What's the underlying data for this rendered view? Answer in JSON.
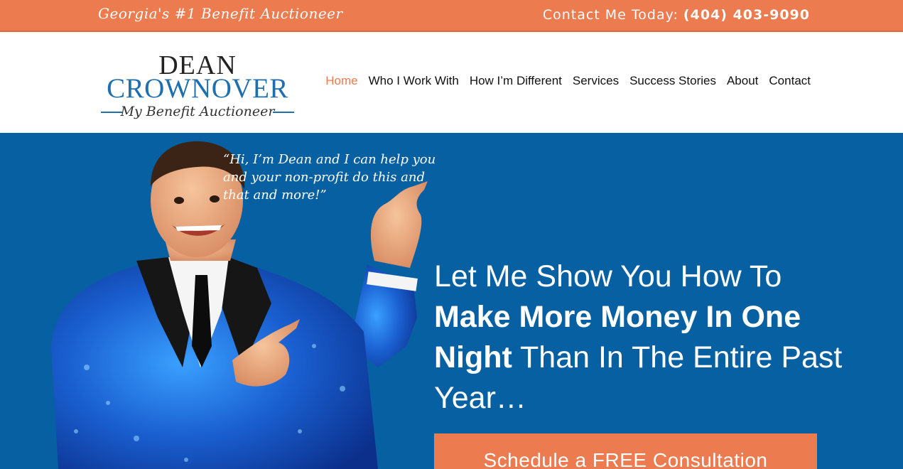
{
  "topbar": {
    "tagline": "Georgia's #1 Benefit Auctioneer",
    "contact_label": "Contact Me Today:",
    "phone": "(404) 403-9090"
  },
  "logo": {
    "line1": "DEAN",
    "line2": "CROWNOVER",
    "line3": "My Benefit Auctioneer"
  },
  "nav": {
    "items": [
      {
        "label": "Home",
        "active": true
      },
      {
        "label": "Who I Work With"
      },
      {
        "label": "How I’m Different"
      },
      {
        "label": "Services"
      },
      {
        "label": "Success Stories"
      },
      {
        "label": "About"
      },
      {
        "label": "Contact"
      }
    ]
  },
  "hero": {
    "speech_line1": "“Hi, I’m Dean and I can help you",
    "speech_line2": "and your non-profit do this and",
    "speech_line3": "that and more!”",
    "headline_part1": "Let Me Show You How To",
    "headline_bold": "Make More Money In One Night",
    "headline_part2": "Than In The Entire Past Year…",
    "cta_label": "Schedule a FREE Consultation"
  },
  "colors": {
    "accent": "#ec7b50",
    "hero_bg": "#0760a1",
    "logo_blue": "#1f6fae"
  }
}
